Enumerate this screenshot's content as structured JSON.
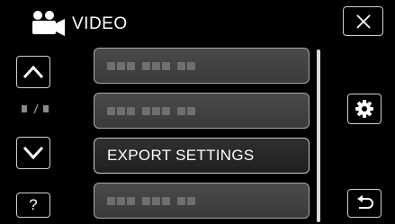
{
  "header": {
    "title": "VIDEO",
    "mode_icon": "video-camera-icon"
  },
  "nav": {
    "up_icon": "chevron-up-icon",
    "down_icon": "chevron-down-icon",
    "page_indicator_icon": "page-indicator-icon",
    "help_label": "?"
  },
  "menu": {
    "items": [
      {
        "label": "",
        "selected": false
      },
      {
        "label": "",
        "selected": false
      },
      {
        "label": "EXPORT SETTINGS",
        "selected": true
      },
      {
        "label": "",
        "selected": false
      }
    ]
  },
  "controls": {
    "close_icon": "close-icon",
    "settings_icon": "gear-icon",
    "back_icon": "return-arrow-icon"
  },
  "colors": {
    "background": "#000000",
    "item_fill": "#444444",
    "item_border": "#a8a8a8",
    "text": "#ffffff"
  }
}
